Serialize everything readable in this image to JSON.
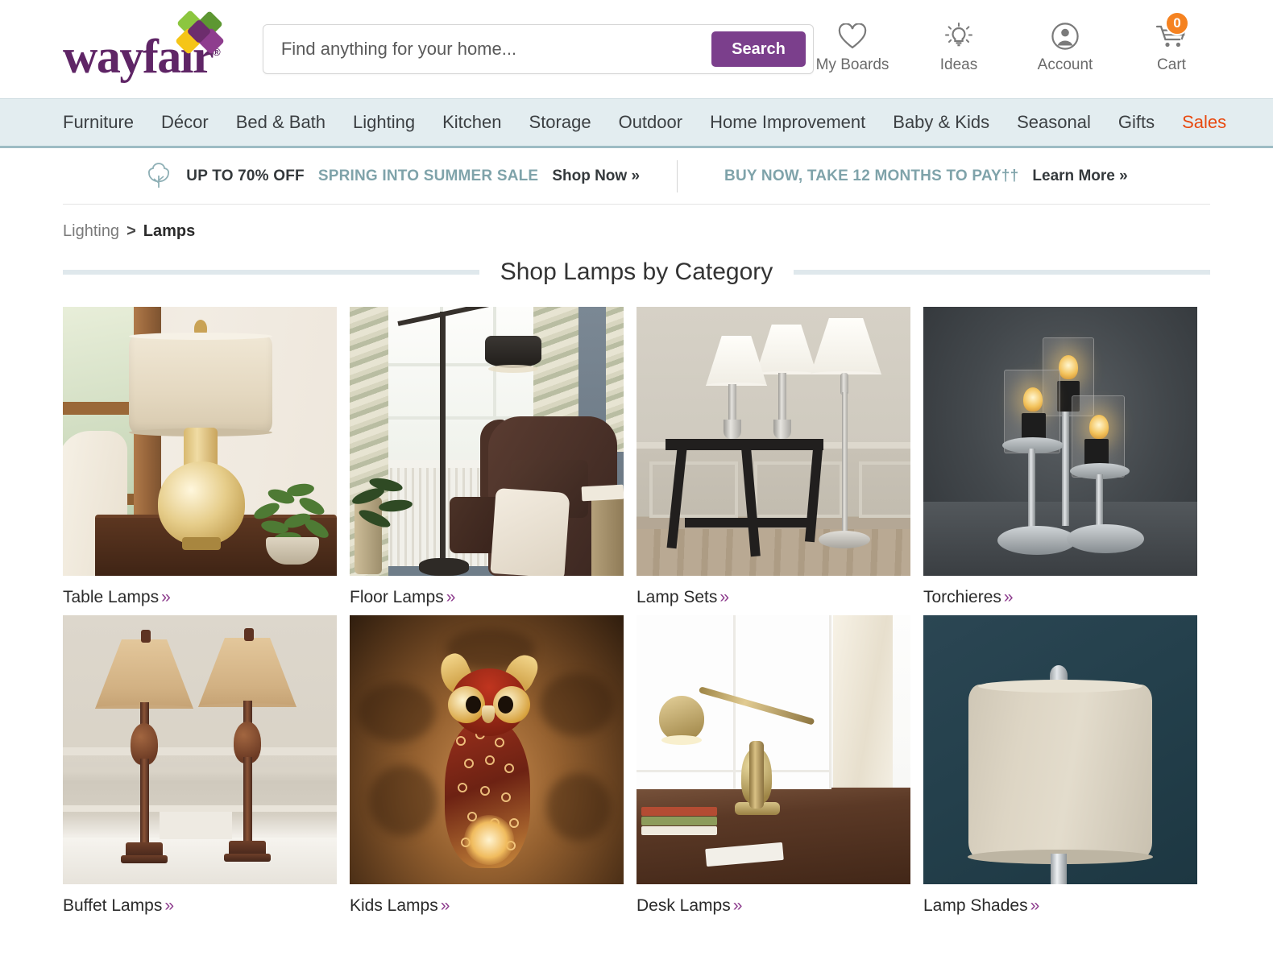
{
  "brand": {
    "name": "wayfair",
    "registered": "®",
    "logo_color": "#5f2566"
  },
  "search": {
    "placeholder": "Find anything for your home...",
    "value": "",
    "button_label": "Search",
    "button_color": "#7b3f8c"
  },
  "utility_nav": [
    {
      "label": "My Boards",
      "icon": "heart-icon"
    },
    {
      "label": "Ideas",
      "icon": "lightbulb-icon"
    },
    {
      "label": "Account",
      "icon": "account-icon"
    },
    {
      "label": "Cart",
      "icon": "cart-icon",
      "badge": "0",
      "badge_color": "#f58220"
    }
  ],
  "main_nav": {
    "items": [
      {
        "label": "Furniture"
      },
      {
        "label": "Décor"
      },
      {
        "label": "Bed & Bath"
      },
      {
        "label": "Lighting"
      },
      {
        "label": "Kitchen"
      },
      {
        "label": "Storage"
      },
      {
        "label": "Outdoor"
      },
      {
        "label": "Home Improvement"
      },
      {
        "label": "Baby & Kids"
      },
      {
        "label": "Seasonal"
      },
      {
        "label": "Gifts"
      },
      {
        "label": "Sales"
      }
    ],
    "highlight_label": "Sales",
    "highlight_color": "#e8490f",
    "background": "#e3edf0"
  },
  "promo": {
    "icon": "tree-icon",
    "left_strong": "UP TO 70% OFF",
    "left_teal": "SPRING INTO SUMMER SALE",
    "left_link": "Shop Now »",
    "right_teal": "BUY NOW, TAKE 12 MONTHS TO PAY††",
    "right_link": "Learn More »",
    "teal_color": "#7fa3aa"
  },
  "breadcrumb": {
    "parent": "Lighting",
    "separator": ">",
    "current": "Lamps"
  },
  "section": {
    "title": "Shop Lamps by Category",
    "rule_color": "#dfe8ec"
  },
  "categories": [
    {
      "label": "Table Lamps",
      "chevron": "»",
      "scene": "table-lamp-scene"
    },
    {
      "label": "Floor Lamps",
      "chevron": "»",
      "scene": "floor-lamp-scene"
    },
    {
      "label": "Lamp Sets",
      "chevron": "»",
      "scene": "lamp-set-scene"
    },
    {
      "label": "Torchieres",
      "chevron": "»",
      "scene": "torchiere-scene"
    },
    {
      "label": "Buffet Lamps",
      "chevron": "»",
      "scene": "buffet-lamp-scene"
    },
    {
      "label": "Kids Lamps",
      "chevron": "»",
      "scene": "kids-owl-lamp-scene"
    },
    {
      "label": "Desk Lamps",
      "chevron": "»",
      "scene": "desk-lamp-scene"
    },
    {
      "label": "Lamp Shades",
      "chevron": "»",
      "scene": "lamp-shade-scene"
    }
  ],
  "accent": {
    "chevron_color": "#8e3d8e",
    "purple": "#7b3f8c",
    "orange": "#f58220"
  }
}
